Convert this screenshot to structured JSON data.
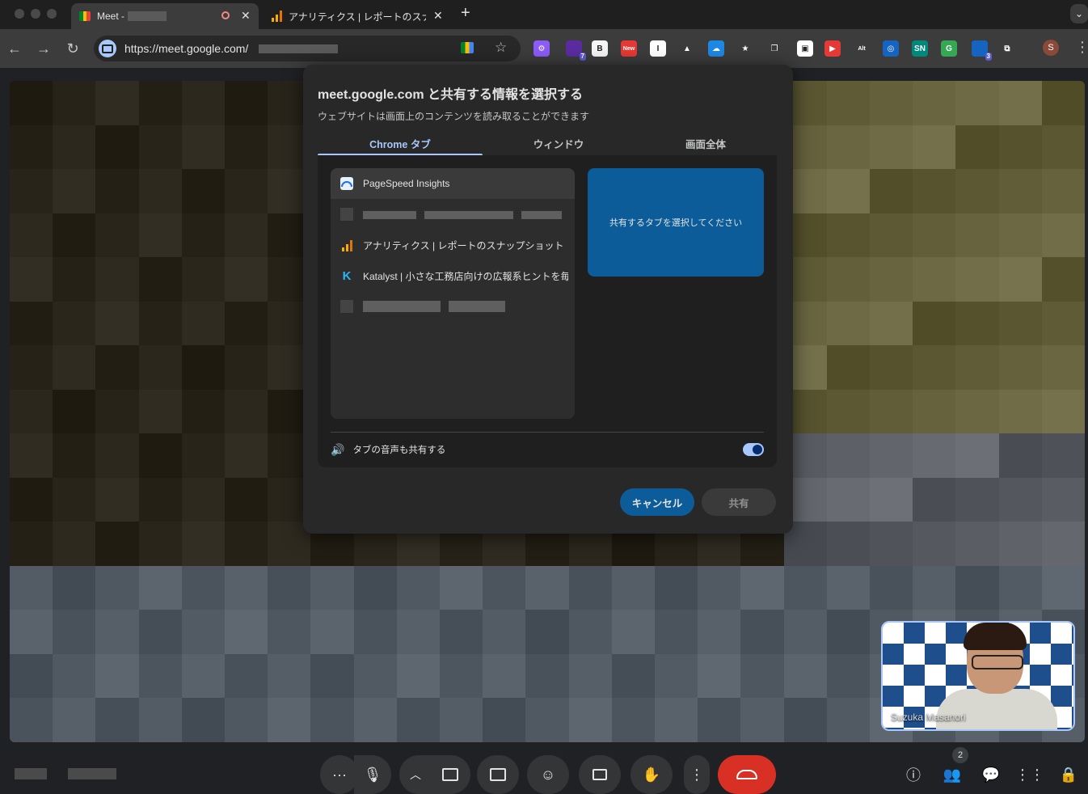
{
  "browser": {
    "tabs": [
      {
        "title": "Meet -",
        "active": true
      },
      {
        "title": "アナリティクス | レポートのスナ",
        "active": false
      }
    ],
    "new_tab_glyph": "+",
    "url": "https://meet.google.com/",
    "extensions": [
      {
        "icon": "gear-extension-icon",
        "label": "⚙",
        "color": "#8b5cf6"
      },
      {
        "icon": "badge-7-extension-icon",
        "label": "",
        "badge": "7",
        "color": "#5b2ca0"
      },
      {
        "icon": "b-extension-icon",
        "label": "B",
        "color": "#f5f5f5"
      },
      {
        "icon": "new-extension-icon",
        "label": "New",
        "color": "#e53935"
      },
      {
        "icon": "i-extension-icon",
        "label": "I",
        "color": "#ffffff"
      },
      {
        "icon": "drive-extension-icon",
        "label": "▲",
        "color": "#3c3c3c"
      },
      {
        "icon": "cloud-extension-icon",
        "label": "☁",
        "color": "#1e88e5"
      },
      {
        "icon": "star-extension-icon",
        "label": "★",
        "color": "#3c3c3c"
      },
      {
        "icon": "copy-extension-icon",
        "label": "❐",
        "color": "#3c3c3c"
      },
      {
        "icon": "window-star-extension-icon",
        "label": "▣",
        "color": "#ffffff"
      },
      {
        "icon": "youtube-extension-icon",
        "label": "▶",
        "color": "#e53935"
      },
      {
        "icon": "alt-extension-icon",
        "label": "Alt",
        "color": "#3c3c3c"
      },
      {
        "icon": "ring-extension-icon",
        "label": "◎",
        "color": "#1565c0"
      },
      {
        "icon": "sn-extension-icon",
        "label": "SN",
        "color": "#00897b"
      },
      {
        "icon": "google-color-extension-icon",
        "label": "G",
        "color": "#34a853"
      },
      {
        "icon": "shield-3-extension-icon",
        "label": "",
        "badge": "3",
        "color": "#1565c0"
      },
      {
        "icon": "puzzle-extension-icon",
        "label": "⧉",
        "color": "#3c3c3c"
      }
    ],
    "profile_initial": "S"
  },
  "dialog": {
    "title": "meet.google.com と共有する情報を選択する",
    "subtitle": "ウェブサイトは画面上のコンテンツを読み取ることができます",
    "tabs": [
      "Chrome タブ",
      "ウィンドウ",
      "画面全体"
    ],
    "tab_list": [
      {
        "name": "PageSpeed Insights",
        "fav": "pagespeed-icon"
      },
      {
        "name": "",
        "fav": "blurred-icon",
        "blurred": true
      },
      {
        "name": "アナリティクス | レポートのスナップショット",
        "fav": "analytics-icon"
      },
      {
        "name": "Katalyst | 小さな工務店向けの広報系ヒントを毎日",
        "fav": "katalyst-icon"
      },
      {
        "name": "",
        "fav": "blurred-icon",
        "blurred": true
      }
    ],
    "preview_text": "共有するタブを選択してください",
    "audio_label": "タブの音声も共有する",
    "audio_on": true,
    "cancel_label": "キャンセル",
    "share_label": "共有"
  },
  "meet": {
    "self_name": "Suzuka Masanori",
    "participant_count": "2",
    "colors": {
      "end_call": "#d93025",
      "accent": "#a8c7fa"
    }
  }
}
